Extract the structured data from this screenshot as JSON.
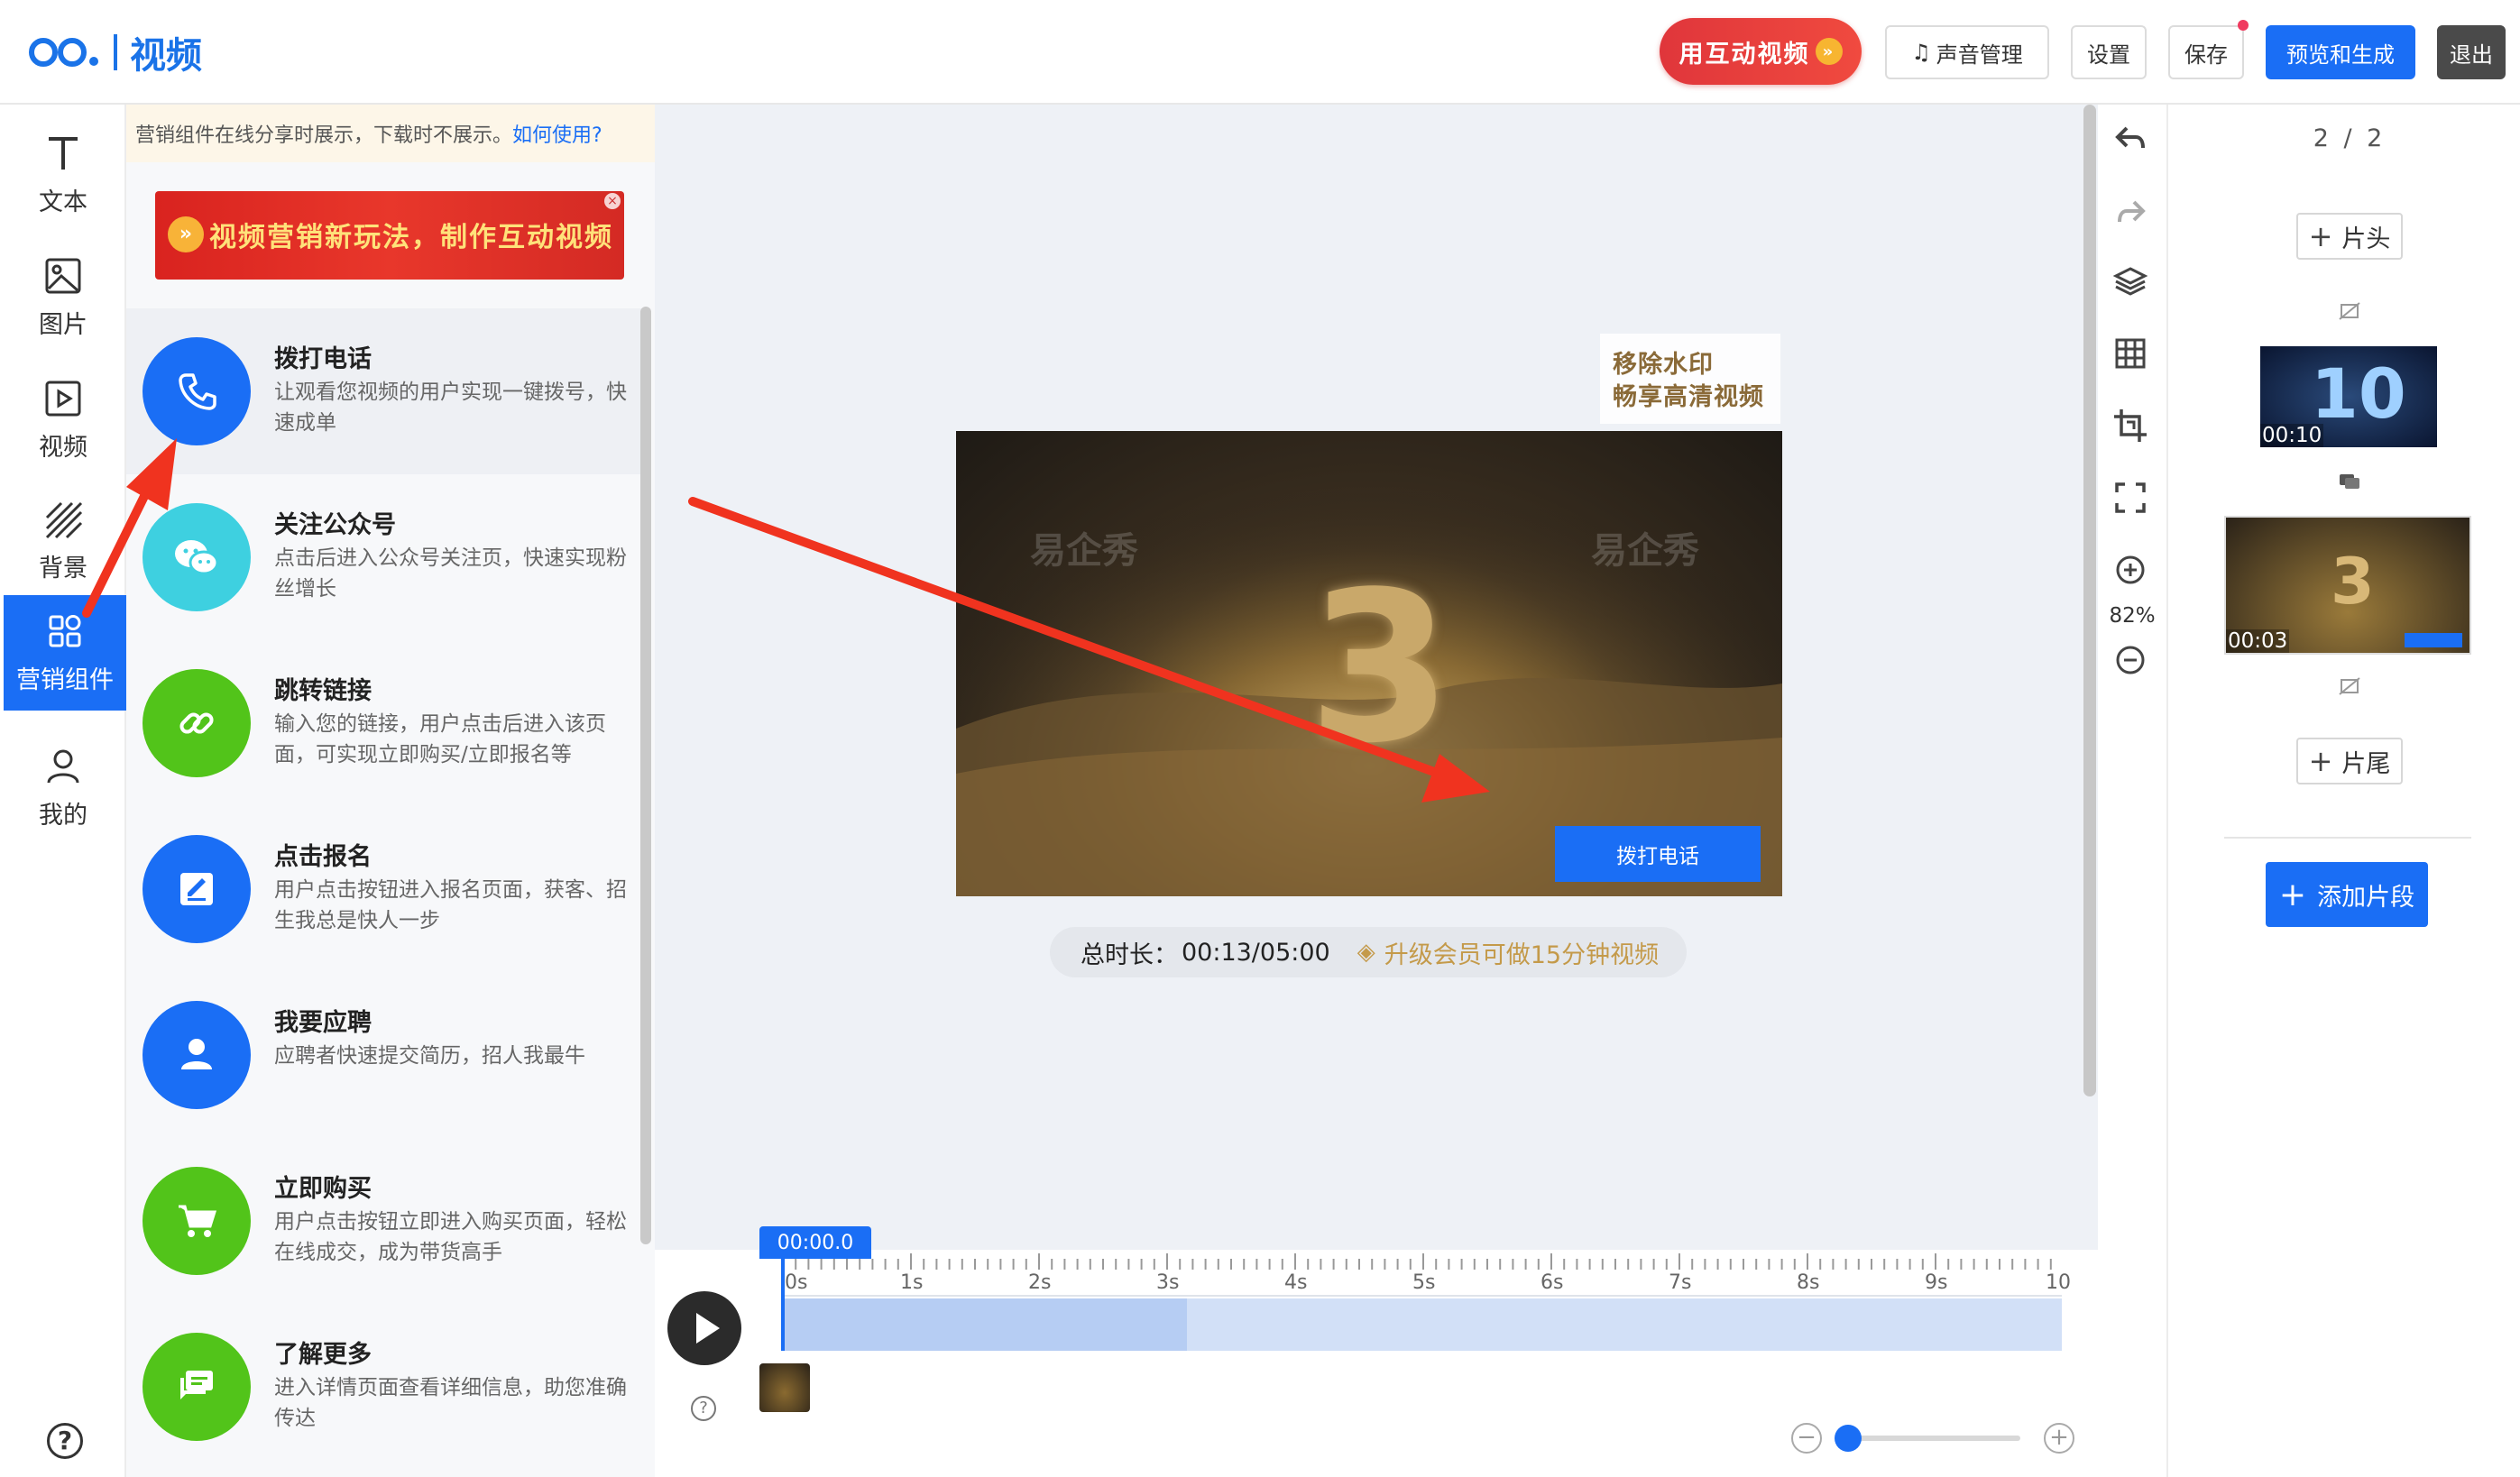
{
  "header": {
    "logo_text": "视频",
    "promo_button": "用互动视频",
    "sound_button": "声音管理",
    "settings_button": "设置",
    "save_button": "保存",
    "preview_button": "预览和生成",
    "exit_button": "退出"
  },
  "rail": {
    "items": [
      {
        "label": "文本",
        "icon": "text-icon"
      },
      {
        "label": "图片",
        "icon": "image-icon"
      },
      {
        "label": "视频",
        "icon": "video-icon"
      },
      {
        "label": "背景",
        "icon": "background-icon"
      },
      {
        "label": "营销组件",
        "icon": "grid-icon"
      },
      {
        "label": "我的",
        "icon": "user-icon"
      }
    ],
    "active": "营销组件"
  },
  "panel": {
    "notice_text": "营销组件在线分享时展示，下载时不展示。",
    "notice_link": "如何使用?",
    "banner_text": "视频营销新玩法，制作互动视频",
    "components": [
      {
        "title": "拨打电话",
        "desc": "让观看您视频的用户实现一键拨号，快速成单",
        "color": "#1a6ef5",
        "icon": "phone-icon"
      },
      {
        "title": "关注公众号",
        "desc": "点击后进入公众号关注页，快速实现粉丝增长",
        "color": "#3ed0e0",
        "icon": "wechat-icon"
      },
      {
        "title": "跳转链接",
        "desc": "输入您的链接，用户点击后进入该页面，可实现立即购买/立即报名等",
        "color": "#52c41a",
        "icon": "link-icon"
      },
      {
        "title": "点击报名",
        "desc": "用户点击按钮进入报名页面，获客、招生我总是快人一步",
        "color": "#1a6ef5",
        "icon": "signup-icon"
      },
      {
        "title": "我要应聘",
        "desc": "应聘者快速提交简历，招人我最牛",
        "color": "#1a6ef5",
        "icon": "person-icon"
      },
      {
        "title": "立即购买",
        "desc": "用户点击按钮立即进入购买页面，轻松在线成交，成为带货高手",
        "color": "#52c41a",
        "icon": "cart-icon"
      },
      {
        "title": "了解更多",
        "desc": "进入详情页面查看详细信息，助您准确传达",
        "color": "#52c41a",
        "icon": "chat-icon"
      }
    ]
  },
  "canvas": {
    "watermark_box_line1": "移除水印",
    "watermark_box_line2": "畅享高清视频",
    "preview_big_number": "3",
    "preview_watermark": "易企秀",
    "preview_call_button": "拨打电话",
    "duration_label": "总时长：",
    "duration_value": "00:13/05:00",
    "upgrade_text": "升级会员可做15分钟视频"
  },
  "toolbar": {
    "zoom": "82%"
  },
  "right_sidebar": {
    "page_indicator": "2 / 2",
    "head_button": "片头",
    "tail_button": "片尾",
    "thumbs": [
      {
        "time": "00:10",
        "big": "10"
      },
      {
        "time": "00:03",
        "big": "3"
      }
    ],
    "add_segment": "添加片段"
  },
  "timeline": {
    "playhead": "00:00.0",
    "ticks": [
      "0s",
      "1s",
      "2s",
      "3s",
      "4s",
      "5s",
      "6s",
      "7s",
      "8s",
      "9s",
      "10"
    ]
  },
  "colors": {
    "accent": "#1a6ef5",
    "annotation_arrow": "#f0331f"
  }
}
